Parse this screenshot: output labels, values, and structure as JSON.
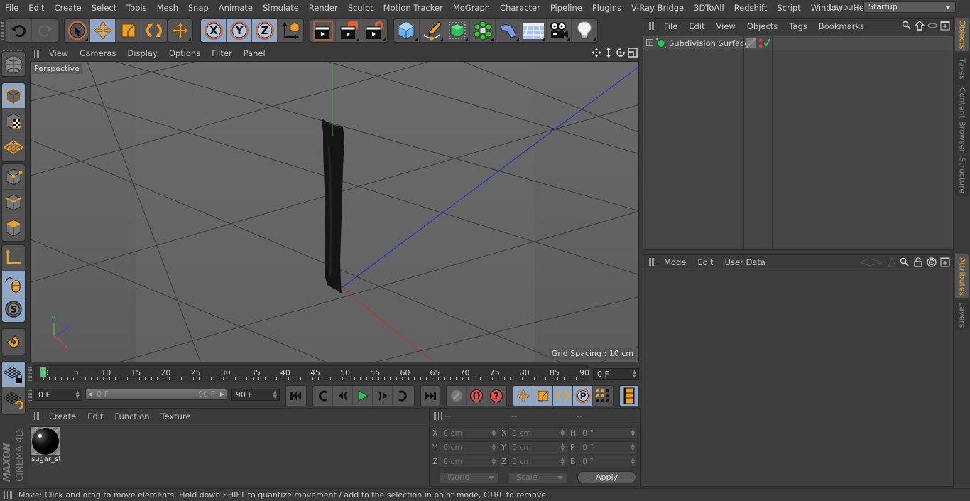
{
  "app": {
    "name": "CINEMA 4D",
    "vendor": "MAXON"
  },
  "menubar": {
    "items": [
      "File",
      "Edit",
      "Create",
      "Select",
      "Tools",
      "Mesh",
      "Snap",
      "Animate",
      "Simulate",
      "Render",
      "Sculpt",
      "Motion Tracker",
      "MoGraph",
      "Character",
      "Pipeline",
      "Plugins",
      "V-Ray Bridge",
      "3DToAll",
      "Redshift",
      "Script",
      "Window",
      "Help"
    ],
    "layout_label": "Layout:",
    "layout_value": "Startup"
  },
  "toolbar": {
    "groups": [
      {
        "name": "history",
        "buttons": [
          {
            "icon": "undo-icon",
            "active": false
          },
          {
            "icon": "redo-icon",
            "active": false
          }
        ]
      },
      {
        "name": "tools",
        "buttons": [
          {
            "icon": "live-selection-icon",
            "active": false
          },
          {
            "icon": "move-icon",
            "active": true
          },
          {
            "icon": "scale-icon",
            "active": false
          },
          {
            "icon": "rotate-icon",
            "active": false
          }
        ]
      },
      {
        "name": "recent",
        "buttons": [
          {
            "icon": "recent-tool-move-icon",
            "active": false
          }
        ]
      },
      {
        "name": "axis",
        "buttons": [
          {
            "icon": "x-axis-icon",
            "label": "X",
            "active": true
          },
          {
            "icon": "y-axis-icon",
            "label": "Y",
            "active": true
          },
          {
            "icon": "z-axis-icon",
            "label": "Z",
            "active": true
          },
          {
            "icon": "coordinate-system-icon",
            "active": false
          }
        ]
      },
      {
        "name": "render",
        "buttons": [
          {
            "icon": "render-view-icon",
            "active": false
          },
          {
            "icon": "render-picture-viewer-icon",
            "active": false
          },
          {
            "icon": "render-settings-icon",
            "active": false
          }
        ]
      },
      {
        "name": "create",
        "buttons": [
          {
            "icon": "cube-icon",
            "active": false
          },
          {
            "icon": "pen-spline-icon",
            "active": false
          },
          {
            "icon": "subdivision-surface-icon",
            "active": false
          },
          {
            "icon": "cloner-icon",
            "active": false
          },
          {
            "icon": "bend-deformer-icon",
            "active": false
          },
          {
            "icon": "floor-icon",
            "active": false
          },
          {
            "icon": "camera-icon",
            "active": false
          },
          {
            "icon": "light-icon",
            "active": false
          }
        ]
      }
    ]
  },
  "left_tools": [
    {
      "icon": "make-editable-icon",
      "active": false
    },
    {
      "icon": "model-mode-icon",
      "active": true
    },
    {
      "icon": "texture-mode-icon",
      "active": false
    },
    {
      "icon": "workplane-icon",
      "active": false
    },
    {
      "icon": "points-mode-icon",
      "active": false
    },
    {
      "icon": "edges-mode-icon",
      "active": false
    },
    {
      "icon": "polygons-mode-icon",
      "active": false
    },
    {
      "icon": "enable-axis-icon",
      "active": false
    },
    {
      "icon": "tweak-mode-icon",
      "active": true
    },
    {
      "icon": "solo-icon",
      "active": true
    },
    {
      "icon": "snap-icon",
      "active": false
    },
    {
      "icon": "workplane-lock-icon",
      "active": true
    },
    {
      "icon": "workplane-align-icon",
      "active": false
    }
  ],
  "viewport": {
    "menus": [
      "View",
      "Cameras",
      "Display",
      "Options",
      "Filter",
      "Panel"
    ],
    "camera_label": "Perspective",
    "grid_spacing": "Grid Spacing : 10 cm",
    "axis_labels": {
      "x": "X",
      "y": "Y",
      "z": "Z"
    },
    "colors": {
      "x_axis": "#c83c3c",
      "y_axis": "#3cb43c",
      "z_axis": "#3c3cc8"
    }
  },
  "timeline": {
    "ticks": [
      "0",
      "5",
      "10",
      "15",
      "20",
      "25",
      "30",
      "35",
      "40",
      "45",
      "50",
      "55",
      "60",
      "65",
      "70",
      "75",
      "80",
      "85",
      "90"
    ],
    "current_frame": "0 F",
    "start_frame": "0 F",
    "range_start": "0 F",
    "range_end": "90 F",
    "end_frame": "90 F",
    "min": 0,
    "max": 90,
    "playhead": 0
  },
  "transport": {
    "buttons": [
      "go-to-start-icon",
      "previous-key-icon",
      "play-backwards-icon",
      "play-forwards-icon",
      "next-frame-icon",
      "next-key-icon",
      "go-to-end-icon"
    ],
    "record": [
      "motion-path-icon",
      "record-active-objects-icon",
      "autokeying-icon"
    ],
    "key_types": [
      "key-position-icon",
      "key-scale-icon",
      "key-rotation-icon",
      "key-parameter-icon",
      "key-point-level-icon"
    ],
    "timeline_button": "timeline-icon"
  },
  "material_manager": {
    "menus": [
      "Create",
      "Edit",
      "Function",
      "Texture"
    ],
    "materials": [
      {
        "name": "sugar_st"
      }
    ]
  },
  "coordinates": {
    "headers": [
      "--",
      "--",
      "--"
    ],
    "rows": [
      {
        "pos_label": "X",
        "pos": "0 cm",
        "size_label": "X",
        "size": "0 cm",
        "rot_label": "H",
        "rot": "0 °"
      },
      {
        "pos_label": "Y",
        "pos": "0 cm",
        "size_label": "Y",
        "size": "0 cm",
        "rot_label": "P",
        "rot": "0 °"
      },
      {
        "pos_label": "Z",
        "pos": "0 cm",
        "size_label": "Z",
        "size": "0 cm",
        "rot_label": "B",
        "rot": "0 °"
      }
    ],
    "mode_dropdown": "World",
    "size_dropdown": "Scale",
    "apply_label": "Apply"
  },
  "object_manager": {
    "menus": [
      "File",
      "Edit",
      "View",
      "Objects",
      "Tags",
      "Bookmarks"
    ],
    "objects": [
      {
        "name": "Subdivision Surface",
        "expanded": false
      }
    ]
  },
  "attribute_manager": {
    "menus": [
      "Mode",
      "Edit",
      "User Data"
    ]
  },
  "right_tabs": {
    "top": [
      {
        "label": "Objects",
        "active": true
      },
      {
        "label": "Takes",
        "active": false
      },
      {
        "label": "Content Browser",
        "active": false
      },
      {
        "label": "Structure",
        "active": false
      }
    ],
    "bottom": [
      {
        "label": "Attributes",
        "active": true
      },
      {
        "label": "Layers",
        "active": false
      }
    ]
  },
  "status": {
    "text": "Move: Click and drag to move elements. Hold down SHIFT to quantize movement / add to the selection in point mode, CTRL to remove."
  }
}
